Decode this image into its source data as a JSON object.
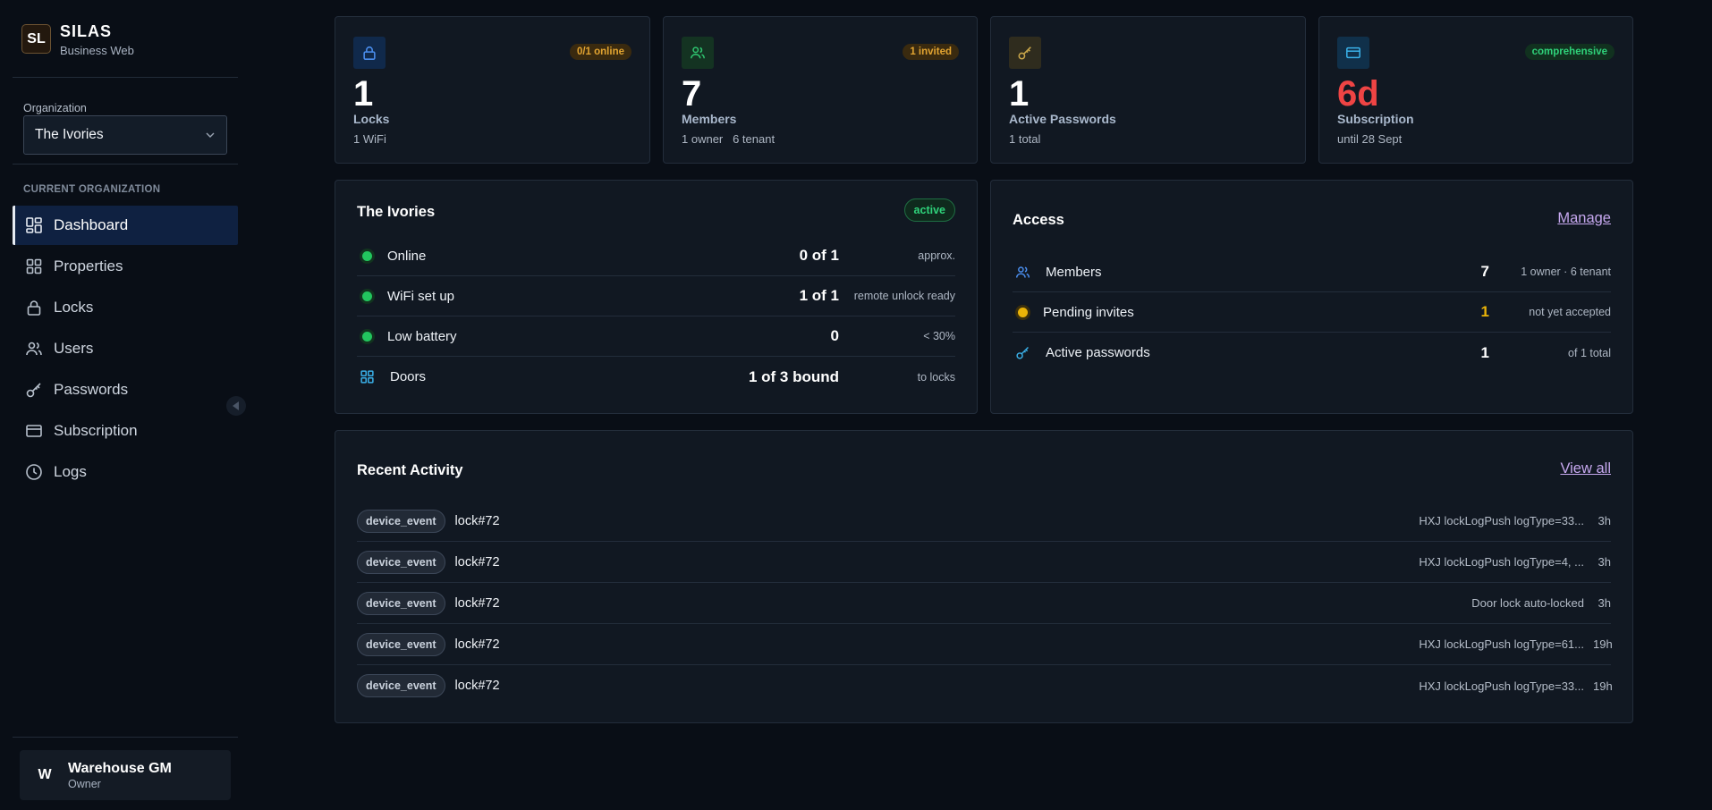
{
  "brand": {
    "initials": "SL",
    "name": "SILAS",
    "subtitle": "Business Web"
  },
  "org": {
    "label": "Organization",
    "selected": "The Ivories"
  },
  "sidebar": {
    "section_label": "CURRENT ORGANIZATION",
    "items": [
      {
        "label": "Dashboard",
        "icon": "dashboard-icon",
        "active": true
      },
      {
        "label": "Properties",
        "icon": "grid-icon"
      },
      {
        "label": "Locks",
        "icon": "lock-icon"
      },
      {
        "label": "Users",
        "icon": "users-icon"
      },
      {
        "label": "Passwords",
        "icon": "key-icon"
      },
      {
        "label": "Subscription",
        "icon": "card-icon"
      },
      {
        "label": "Logs",
        "icon": "clock-icon"
      }
    ]
  },
  "user": {
    "initial": "W",
    "name": "Warehouse GM",
    "role": "Owner"
  },
  "stats": [
    {
      "icon": "lock-icon",
      "badge": "0/1 online",
      "value": "1",
      "label": "Locks",
      "sub": "1 WiFi"
    },
    {
      "icon": "users-icon",
      "badge": "1 invited",
      "value": "7",
      "label": "Members",
      "sub": "1 owner   6 tenant"
    },
    {
      "icon": "key-icon",
      "badge": "",
      "value": "1",
      "label": "Active Passwords",
      "sub": "1 total"
    },
    {
      "icon": "card-icon",
      "badge": "comprehensive",
      "value": "6d",
      "label": "Subscription",
      "sub": "until 28 Sept"
    }
  ],
  "property": {
    "title": "The Ivories",
    "status": "active",
    "rows": [
      {
        "label": "Online",
        "value": "0 of 1",
        "note": "approx."
      },
      {
        "label": "WiFi set up",
        "value": "1 of 1",
        "note": "remote unlock ready"
      },
      {
        "label": "Low battery",
        "value": "0",
        "note": "< 30%"
      },
      {
        "label": "Doors",
        "value": "1 of 3 bound",
        "note": "to locks"
      }
    ]
  },
  "access": {
    "title": "Access",
    "manage_label": "Manage",
    "rows": [
      {
        "label": "Members",
        "value": "7",
        "note": "1 owner · 6 tenant"
      },
      {
        "label": "Pending invites",
        "value": "1",
        "note": "not yet accepted"
      },
      {
        "label": "Active passwords",
        "value": "1",
        "note": "of 1 total"
      }
    ]
  },
  "activity": {
    "title": "Recent Activity",
    "view_all_label": "View all",
    "rows": [
      {
        "tag": "device_event",
        "target": "lock#72",
        "desc": "HXJ lockLogPush logType=33...",
        "time": "3h"
      },
      {
        "tag": "device_event",
        "target": "lock#72",
        "desc": "HXJ lockLogPush logType=4, ...",
        "time": "3h"
      },
      {
        "tag": "device_event",
        "target": "lock#72",
        "desc": "Door lock auto-locked",
        "time": "3h"
      },
      {
        "tag": "device_event",
        "target": "lock#72",
        "desc": "HXJ lockLogPush logType=61...",
        "time": "19h"
      },
      {
        "tag": "device_event",
        "target": "lock#72",
        "desc": "HXJ lockLogPush logType=33...",
        "time": "19h"
      }
    ]
  },
  "colors": {
    "background": "#090e16",
    "card": "#111822",
    "accent_active_nav": "#0f2141",
    "danger": "#ef4444",
    "success": "#22c55e",
    "warning": "#eab308",
    "link": "#c6a8ef"
  }
}
